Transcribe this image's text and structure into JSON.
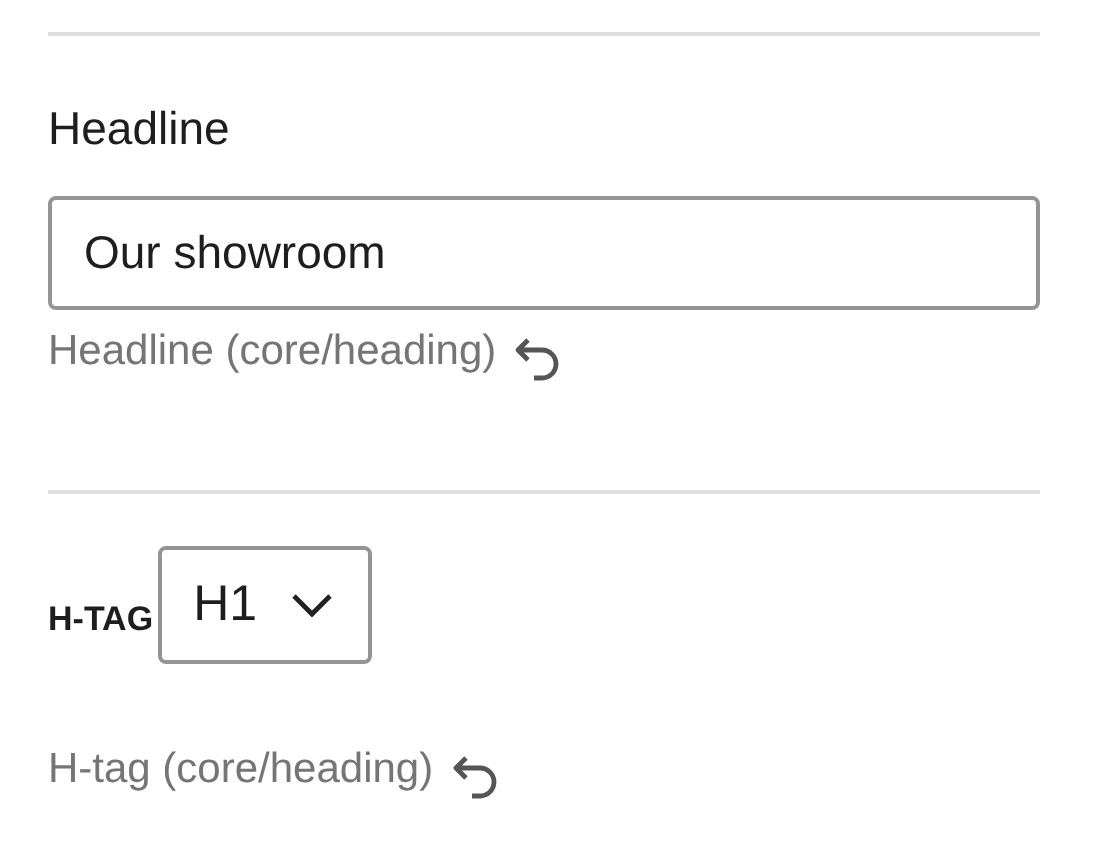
{
  "sections": [
    {
      "kind": "text",
      "label": "Headline",
      "value": "Our showroom",
      "help": "Headline (core/heading)"
    },
    {
      "kind": "select",
      "label": "H-TAG",
      "value": "H1",
      "help": "H-tag (core/heading)"
    }
  ]
}
